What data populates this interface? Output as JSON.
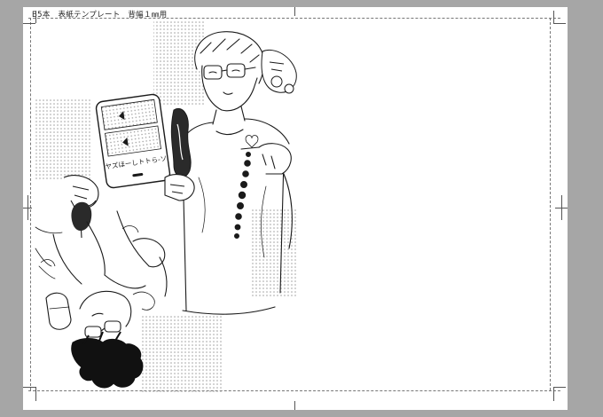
{
  "template": {
    "title": "B5本　表紙テンプレート　背幅１㎜用"
  },
  "colors": {
    "workspace": "#a6a6a6",
    "paper": "#ffffff",
    "ink": "#1a1a1a",
    "screentone": "#9a9a9a"
  },
  "artwork": {
    "phone_screen_text": "ヤズほーしトトら-ソ"
  }
}
